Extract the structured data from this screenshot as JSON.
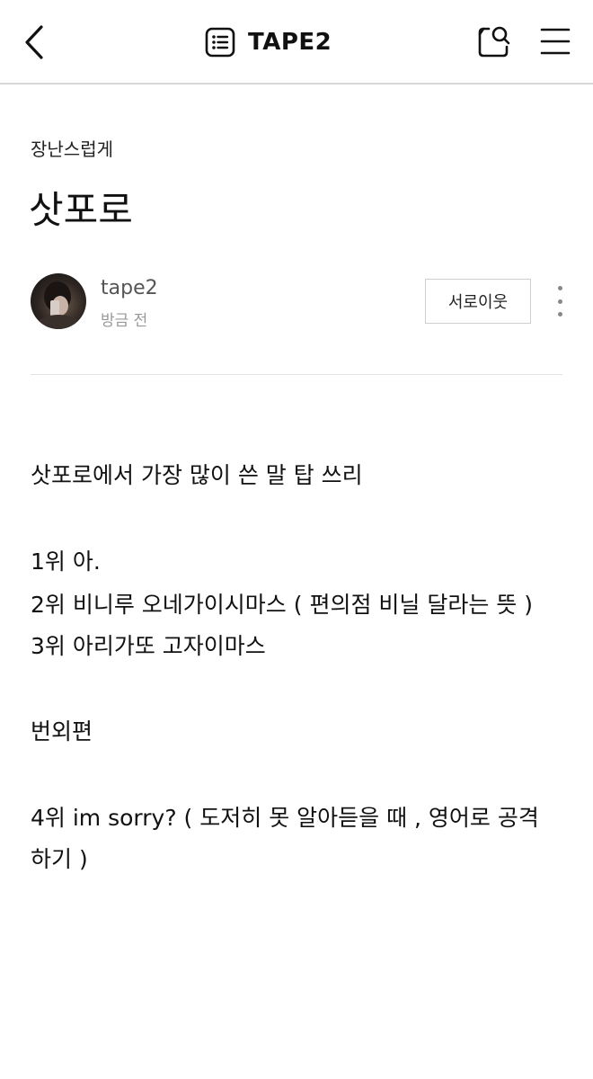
{
  "header": {
    "blog_title": "TAPE2",
    "icons": {
      "back": "chevron-left-icon",
      "list": "list-icon",
      "search": "search-icon",
      "menu": "hamburger-icon"
    }
  },
  "post": {
    "category": "장난스럽게",
    "title": "삿포로",
    "author": "tape2",
    "time": "방금 전",
    "neighbor_button": "서로이웃",
    "body": [
      "삿포로에서 가장 많이 쓴 말 탑 쓰리",
      "1위 아.",
      "2위 비니루 오네가이시마스 ( 편의점 비닐 달라는 뜻 )",
      "3위 아리가또 고자이마스",
      "번외편",
      "4위 im sorry? ( 도저히 못 알아듣을 때 , 영어로 공격",
      "하기 )"
    ]
  }
}
